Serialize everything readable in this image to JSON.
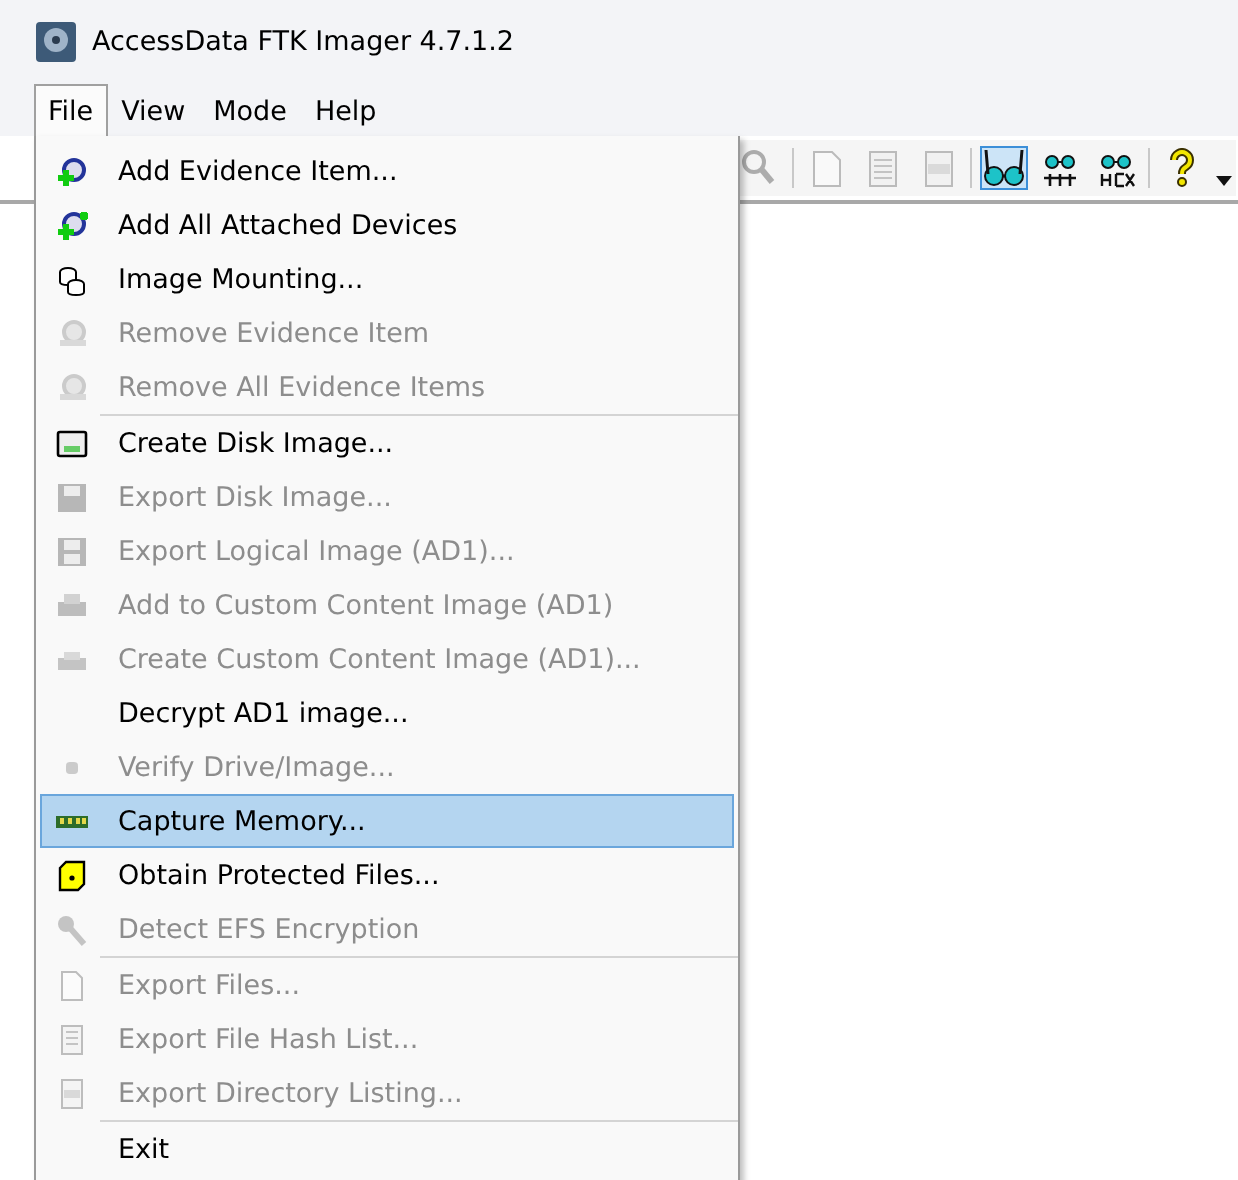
{
  "window": {
    "title": "AccessData FTK Imager 4.7.1.2"
  },
  "menu_bar": [
    {
      "label": "File",
      "selected": true
    },
    {
      "label": "View",
      "selected": false
    },
    {
      "label": "Mode",
      "selected": false
    },
    {
      "label": "Help",
      "selected": false
    }
  ],
  "toolbar": [
    {
      "kind": "button",
      "disabled": true,
      "selected": false
    },
    {
      "kind": "separator"
    },
    {
      "kind": "button",
      "disabled": true,
      "selected": false
    },
    {
      "kind": "button",
      "disabled": true,
      "selected": false
    },
    {
      "kind": "button",
      "disabled": true,
      "selected": false
    },
    {
      "kind": "separator"
    },
    {
      "kind": "button",
      "disabled": false,
      "selected": true
    },
    {
      "kind": "button",
      "disabled": false,
      "selected": false
    },
    {
      "kind": "button",
      "disabled": false,
      "selected": false
    },
    {
      "kind": "separator"
    },
    {
      "kind": "button",
      "disabled": false,
      "selected": false
    },
    {
      "kind": "overflow"
    }
  ],
  "file_menu": [
    {
      "kind": "item",
      "label": "Add Evidence Item...",
      "disabled": false,
      "selected": false
    },
    {
      "kind": "item",
      "label": "Add All Attached Devices",
      "disabled": false,
      "selected": false
    },
    {
      "kind": "item",
      "label": "Image Mounting...",
      "disabled": false,
      "selected": false
    },
    {
      "kind": "item",
      "label": "Remove Evidence Item",
      "disabled": true,
      "selected": false
    },
    {
      "kind": "item",
      "label": "Remove All Evidence Items",
      "disabled": true,
      "selected": false
    },
    {
      "kind": "separator"
    },
    {
      "kind": "item",
      "label": "Create Disk Image...",
      "disabled": false,
      "selected": false
    },
    {
      "kind": "item",
      "label": "Export Disk Image...",
      "disabled": true,
      "selected": false
    },
    {
      "kind": "item",
      "label": "Export Logical Image (AD1)...",
      "disabled": true,
      "selected": false
    },
    {
      "kind": "item",
      "label": "Add to Custom Content Image (AD1)",
      "disabled": true,
      "selected": false
    },
    {
      "kind": "item",
      "label": "Create Custom Content Image (AD1)...",
      "disabled": true,
      "selected": false
    },
    {
      "kind": "item",
      "label": "Decrypt AD1 image...",
      "disabled": false,
      "selected": false
    },
    {
      "kind": "item",
      "label": "Verify Drive/Image...",
      "disabled": true,
      "selected": false
    },
    {
      "kind": "item",
      "label": "Capture Memory...",
      "disabled": false,
      "selected": true
    },
    {
      "kind": "item",
      "label": "Obtain Protected Files...",
      "disabled": false,
      "selected": false
    },
    {
      "kind": "item",
      "label": "Detect EFS Encryption",
      "disabled": true,
      "selected": false
    },
    {
      "kind": "separator"
    },
    {
      "kind": "item",
      "label": "Export Files...",
      "disabled": true,
      "selected": false
    },
    {
      "kind": "item",
      "label": "Export File Hash List...",
      "disabled": true,
      "selected": false
    },
    {
      "kind": "item",
      "label": "Export Directory Listing...",
      "disabled": true,
      "selected": false
    },
    {
      "kind": "separator"
    },
    {
      "kind": "item",
      "label": "Exit",
      "disabled": false,
      "selected": false
    }
  ]
}
